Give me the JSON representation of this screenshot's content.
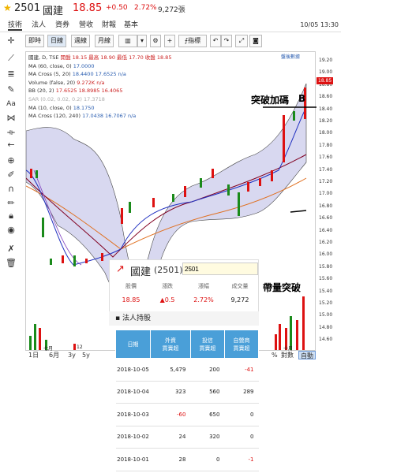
{
  "header": {
    "code": "2501",
    "name": "國建",
    "price": "18.85",
    "change": "+0.50",
    "percent": "2.72%",
    "volume": "9,272張"
  },
  "tabs": [
    {
      "label": "技術",
      "active": true
    },
    {
      "label": "法人",
      "active": false
    },
    {
      "label": "資券",
      "active": false
    },
    {
      "label": "營收",
      "active": false
    },
    {
      "label": "財報",
      "active": false
    },
    {
      "label": "基本",
      "active": false
    }
  ],
  "timestamp": "10/05 13:30",
  "toolbar": {
    "minute": "即時",
    "day": "日線",
    "week": "週線",
    "month": "月線",
    "indicators": "指標",
    "zoom_icon": "gear-icon"
  },
  "chart_legend": {
    "title": "國建, D, TSE",
    "ohlc": "開盤 18.15 最高 18.90 最低 17.70 收盤 18.85",
    "ma60": "MA (60, close, 0)",
    "ma60_val": "17.0000",
    "macross": "MA Cross (5, 20)",
    "macross_val": "18.4400 17.6525 n/a",
    "volume": "Volume (false, 20)",
    "volume_val": "9.272K n/a",
    "bb": "BB (20, 2)",
    "bb_val": "17.6525 18.8985 16.4065",
    "sar": "SAR (0.02, 0.02, 0.2)",
    "sar_val": "17.3718",
    "ma10": "MA (10, close, 0)",
    "ma10_val": "18.1750",
    "macross2": "MA Cross (120, 240)",
    "macross2_val": "17.0438 16.7067 n/a",
    "top_right": "盤後數據"
  },
  "price_tag": "18.85",
  "annotations": {
    "breakout": "突破加碼",
    "b_mark": "B",
    "volume_breakout": "帶量突破"
  },
  "yaxis_ticks": [
    "19.20",
    "19.00",
    "18.80",
    "18.60",
    "18.40",
    "18.20",
    "18.00",
    "17.80",
    "17.60",
    "17.40",
    "17.20",
    "17.00",
    "16.80",
    "16.60",
    "16.40",
    "16.20",
    "16.00",
    "15.80",
    "15.60",
    "15.40",
    "15.20",
    "15.00",
    "14.80",
    "14.60"
  ],
  "xaxis_labels": [
    "七月",
    "12",
    "十月"
  ],
  "bottom_bar": {
    "ranges": [
      "1日",
      "6月",
      "3y",
      "5y"
    ],
    "scale_pct": "%",
    "scale_log": "對數",
    "scale_auto": "自動"
  },
  "popup": {
    "name": "國建",
    "code": "(2501)",
    "input_value": "2501",
    "stats": [
      {
        "label": "股價",
        "value": "18.85",
        "color": "#d11"
      },
      {
        "label": "漲跌",
        "value": "▲0.5",
        "color": "#d11"
      },
      {
        "label": "漲幅",
        "value": "2.72%",
        "color": "#d11"
      },
      {
        "label": "成交量",
        "value": "9,272",
        "color": "#222"
      }
    ]
  },
  "institutional": {
    "title": "法人持股",
    "headers": [
      "日期",
      "外資\n買賣超",
      "投信\n買賣超",
      "自營商\n買賣超"
    ],
    "rows": [
      {
        "date": "2018-10-05",
        "foreign": "5,479",
        "trust": "200",
        "dealer": "-41"
      },
      {
        "date": "2018-10-04",
        "foreign": "323",
        "trust": "560",
        "dealer": "289"
      },
      {
        "date": "2018-10-03",
        "foreign": "-60",
        "trust": "650",
        "dealer": "0"
      },
      {
        "date": "2018-10-02",
        "foreign": "24",
        "trust": "320",
        "dealer": "0"
      },
      {
        "date": "2018-10-01",
        "foreign": "28",
        "trust": "0",
        "dealer": "-1"
      }
    ]
  },
  "colors": {
    "up": "#d11",
    "down": "#1a8a1a",
    "accent": "#4a9fd8",
    "band_fill": "#d8d8f0"
  }
}
